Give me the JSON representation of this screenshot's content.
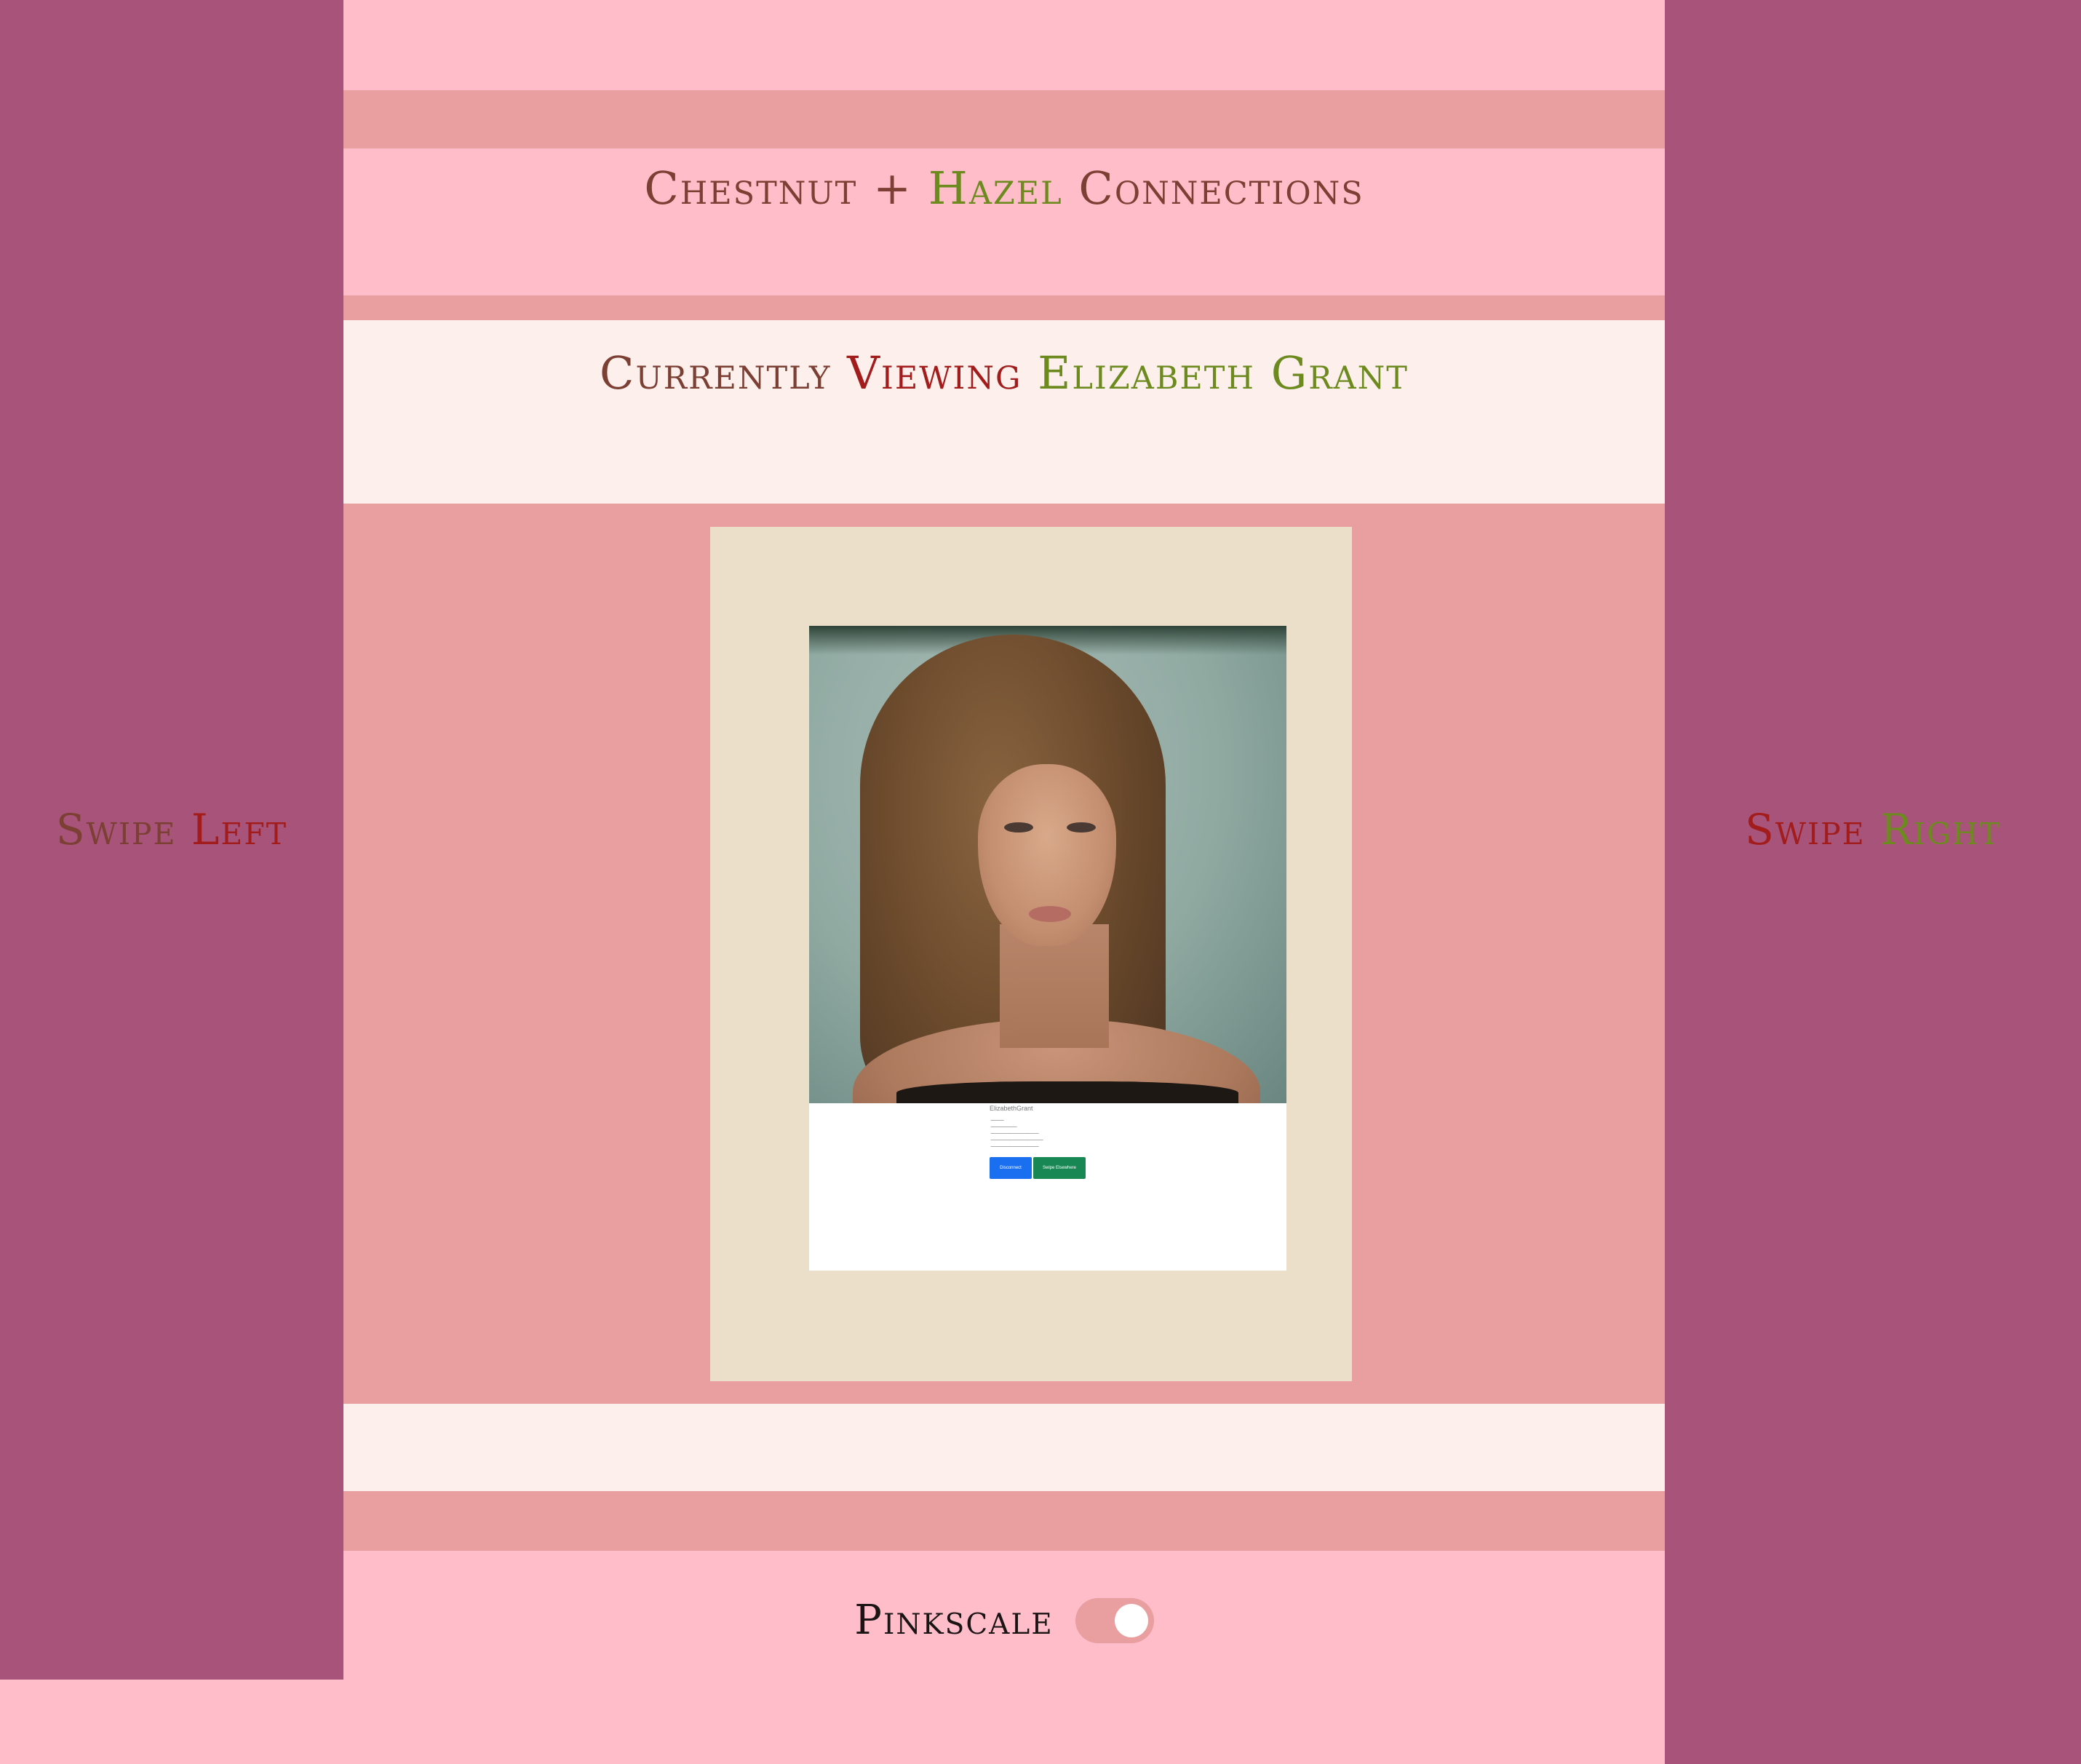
{
  "header": {
    "title_part1": "Chestnut",
    "title_plus": "+",
    "title_part2": "Hazel",
    "title_part3": "Connections"
  },
  "viewing": {
    "prefix": "Currently",
    "verb": "Viewing",
    "name": "Elizabeth Grant"
  },
  "swipe_left": {
    "word": "Swipe",
    "direction": "Left"
  },
  "swipe_right": {
    "word": "Swipe",
    "direction": "Right"
  },
  "profile_card": {
    "name": "ElizabethGrant",
    "buttons": {
      "primary": "Disconnect",
      "secondary": "Swipe Elsewhere"
    }
  },
  "toggle": {
    "label": "Pinkscale",
    "state": "on"
  },
  "colors": {
    "side_panel": "#a8537a",
    "pink_bg": "#ffbdca",
    "rose_band": "#e99e9f",
    "cream_band": "#fdefec",
    "card_frame": "#ecdfc9",
    "title_brown": "#7b3f33",
    "title_green": "#6c8a1e",
    "title_red": "#a21c1c"
  }
}
